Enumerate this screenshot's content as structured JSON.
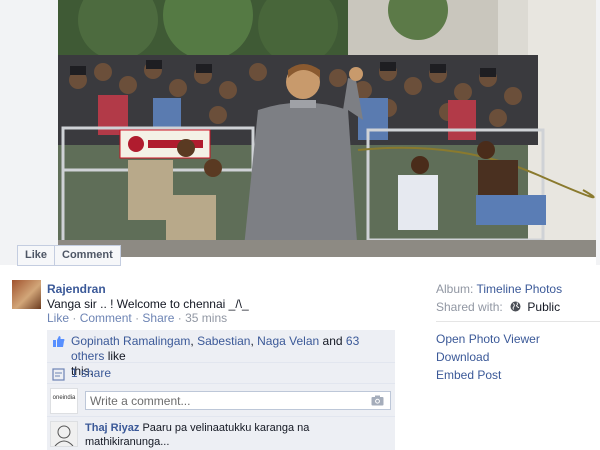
{
  "photo": {
    "like_label": "Like",
    "comment_label": "Comment"
  },
  "post": {
    "author": "Rajendran",
    "message": "Vanga sir .. ! Welcome to chennai _/\\_",
    "actions": {
      "like": "Like",
      "comment": "Comment",
      "share": "Share",
      "separator": "·",
      "time": "35 mins"
    }
  },
  "likes": {
    "names": [
      "Gopinath Ramalingam",
      "Sabestian",
      "Naga Velan"
    ],
    "and_text": "and",
    "others": "63 others",
    "suffix_1": "like",
    "suffix_2": "this."
  },
  "shares": {
    "label": "1 share"
  },
  "comment_input": {
    "placeholder": "Write a comment...",
    "avatar_text": "oneindia"
  },
  "comments": [
    {
      "author": "Thaj Riyaz",
      "text": "Paaru pa velinaatukku karanga na mathikiranunga..."
    }
  ],
  "sidebar": {
    "album_label": "Album:",
    "album_name": "Timeline Photos",
    "shared_label": "Shared with:",
    "shared_value": "Public",
    "actions": [
      "Open Photo Viewer",
      "Download",
      "Embed Post"
    ]
  },
  "colors": {
    "link": "#3b5998",
    "meta": "#9197a3",
    "ufi_bg": "#edeff4"
  }
}
